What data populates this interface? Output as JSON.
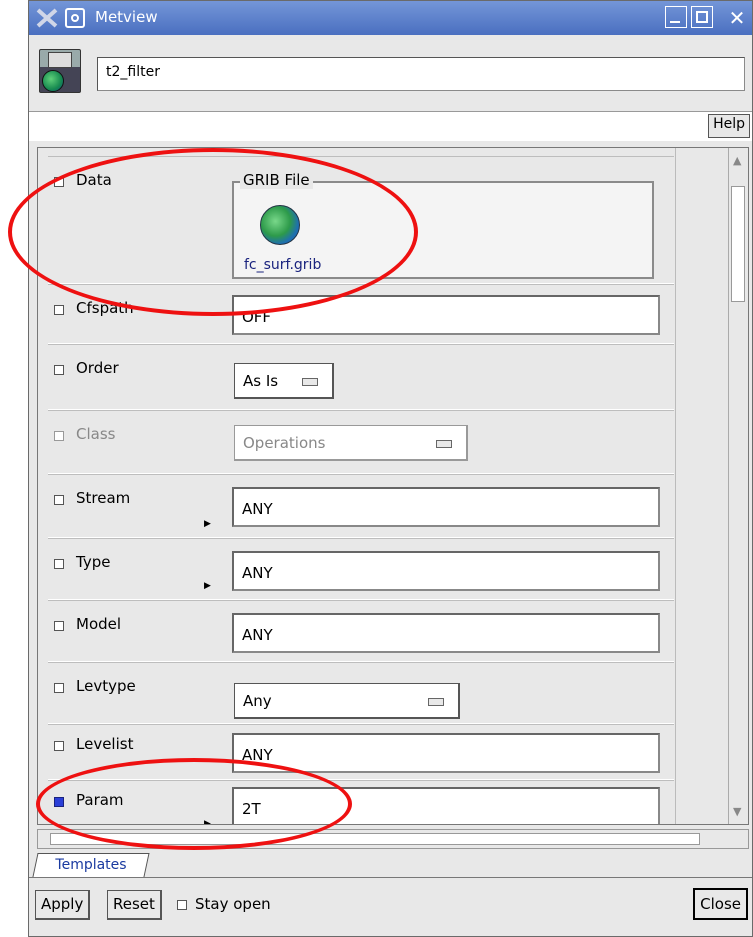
{
  "window": {
    "title": "Metview"
  },
  "header": {
    "icon_name": "metview-icon-editor",
    "name_value": "t2_filter"
  },
  "help": {
    "label": "Help"
  },
  "params": {
    "data": {
      "label": "Data",
      "box_title": "GRIB File",
      "file_name": "fc_surf.grib"
    },
    "cfspath": {
      "label": "Cfspath",
      "value": "OFF"
    },
    "order": {
      "label": "Order",
      "value": "As Is"
    },
    "class": {
      "label": "Class",
      "value": "Operations"
    },
    "stream": {
      "label": "Stream",
      "value": "ANY"
    },
    "type": {
      "label": "Type",
      "value": "ANY"
    },
    "model": {
      "label": "Model",
      "value": "ANY"
    },
    "levtype": {
      "label": "Levtype",
      "value": "Any"
    },
    "levelist": {
      "label": "Levelist",
      "value": "ANY"
    },
    "param": {
      "label": "Param",
      "value": "2T"
    }
  },
  "tabs": {
    "templates": "Templates"
  },
  "footer": {
    "apply": "Apply",
    "reset": "Reset",
    "stay_open": "Stay open",
    "close": "Close"
  },
  "colors": {
    "accent": "#4a6fc0",
    "annotation": "#ee1111",
    "selected_checkbox": "#2a3fd8"
  }
}
